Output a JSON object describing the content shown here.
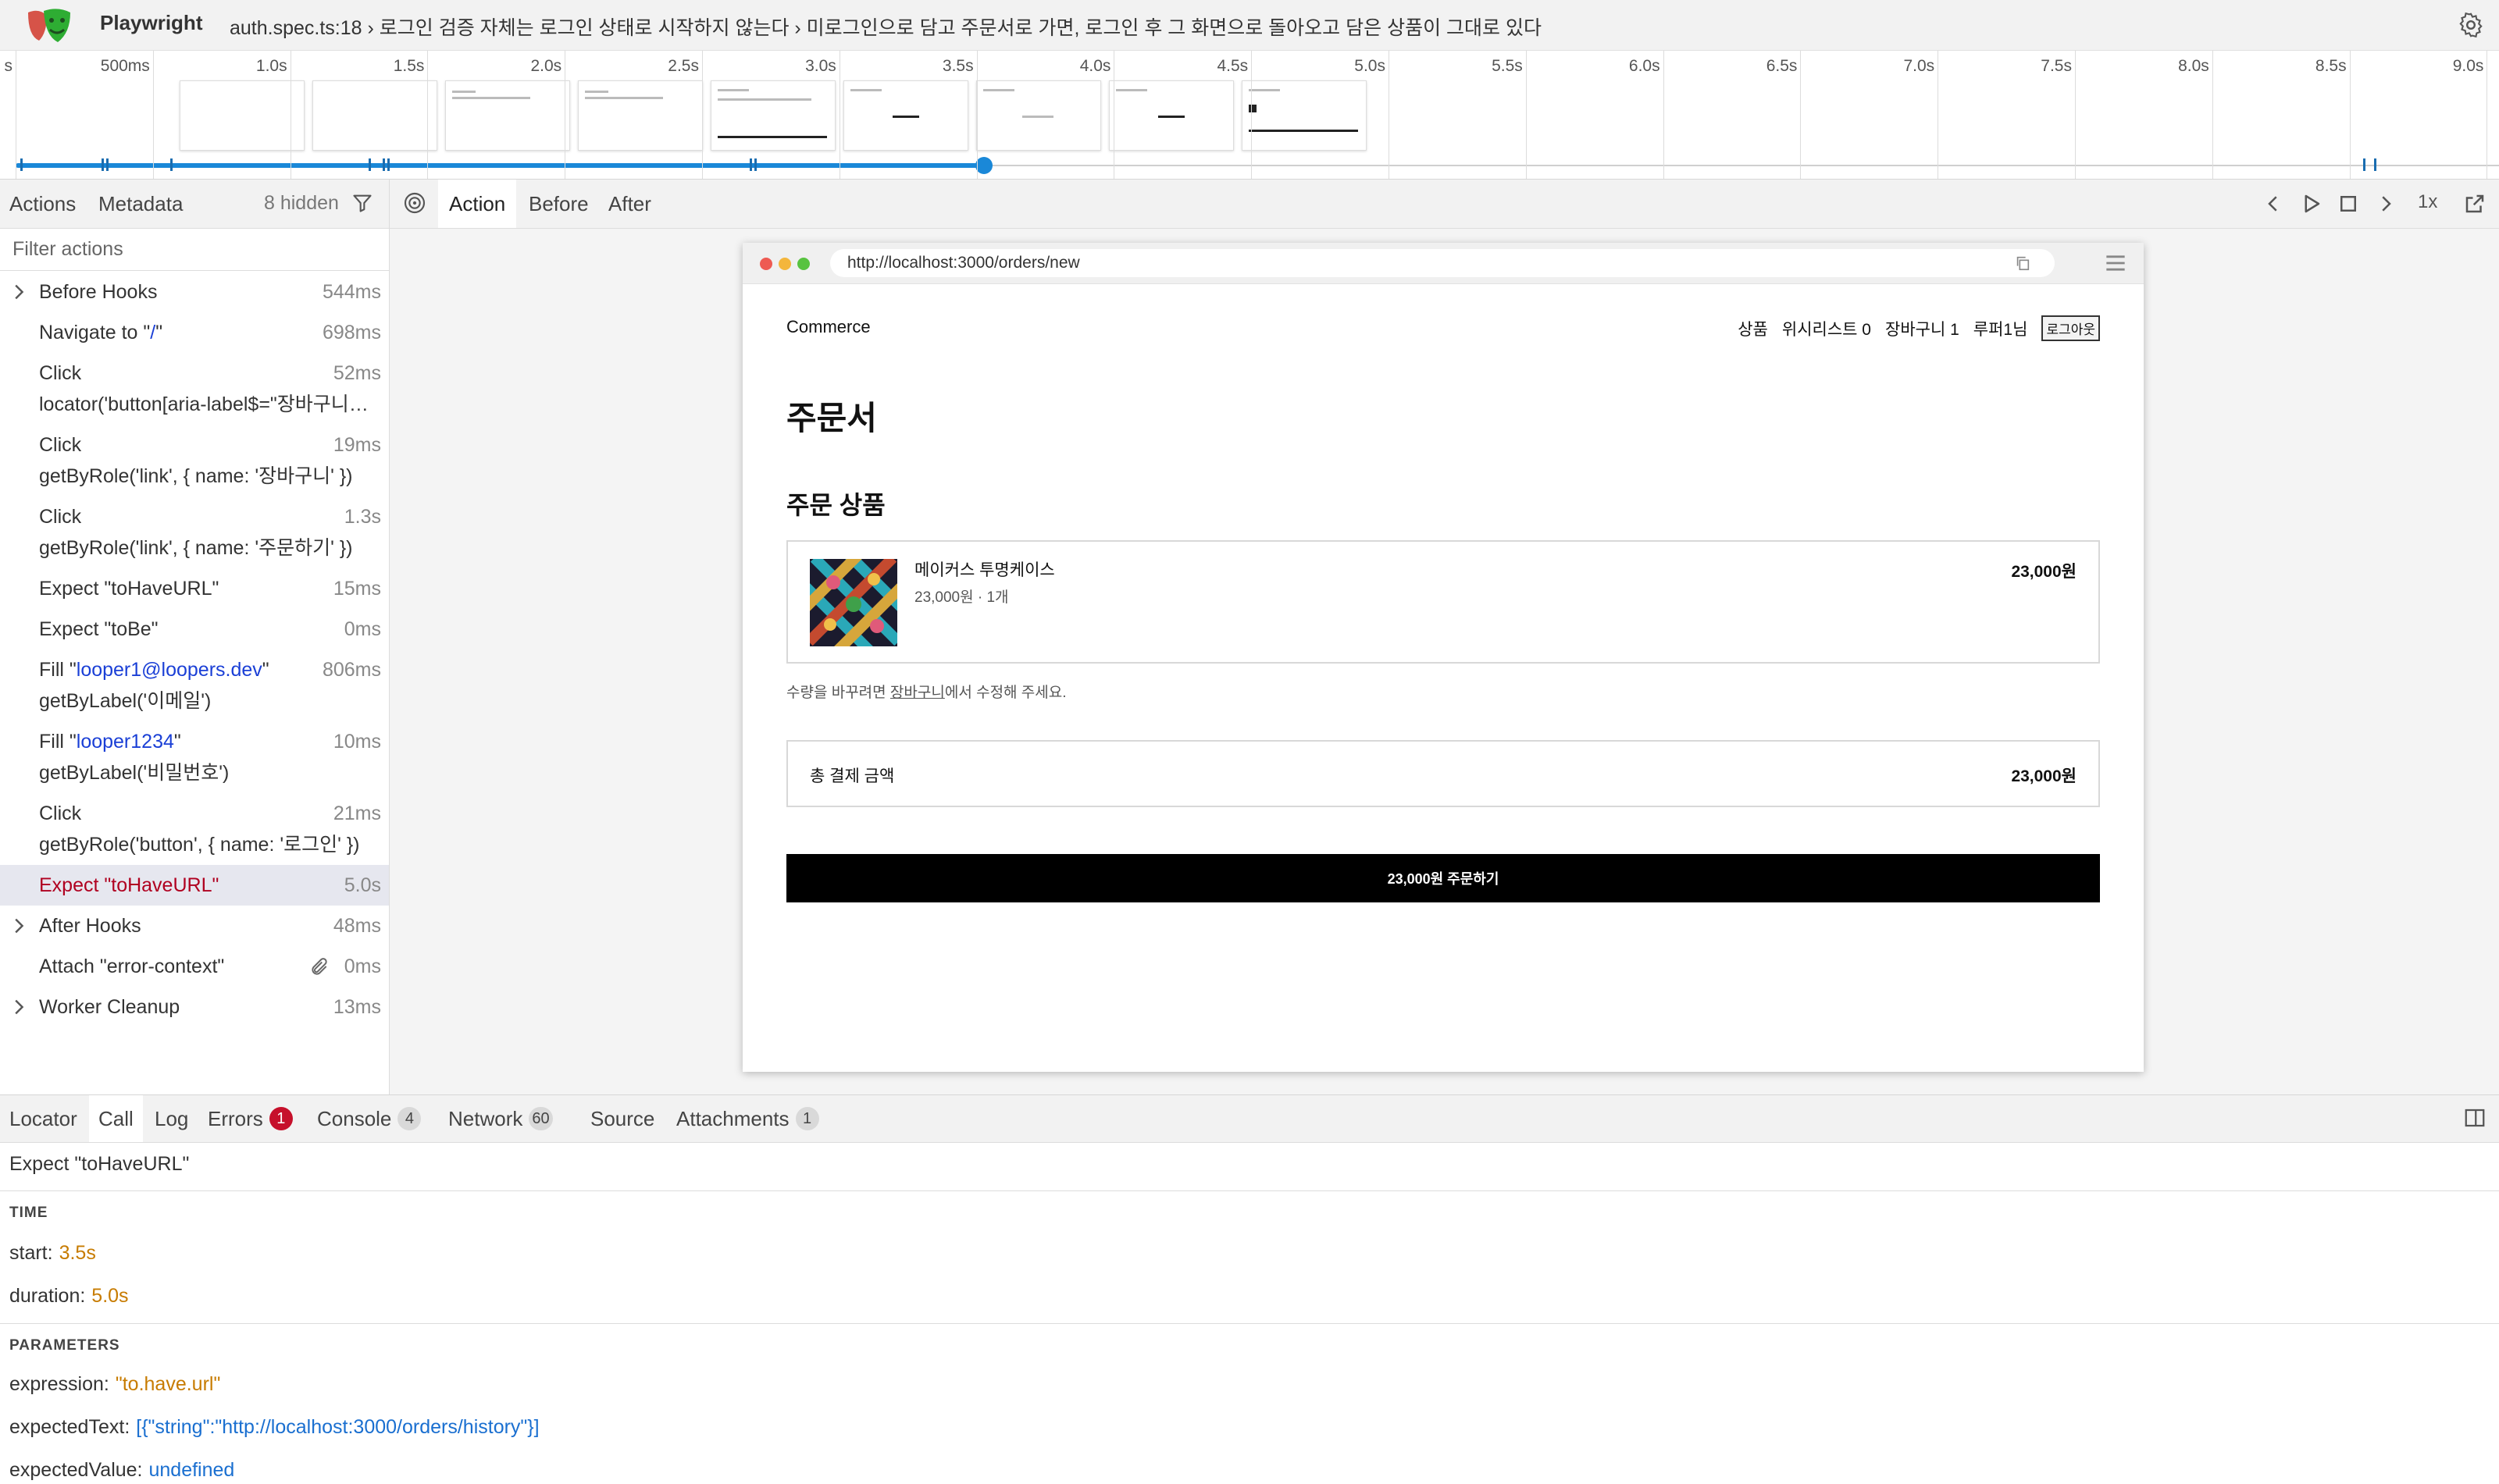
{
  "header": {
    "app_name": "Playwright",
    "title": "auth.spec.ts:18 › 로그인 검증 자체는 로그인 상태로 시작하지 않는다 › 미로그인으로 담고 주문서로 가면, 로그인 후 그 화면으로 돌아오고 담은 상품이 그대로 있다"
  },
  "timeline": {
    "ticks": [
      "s",
      "500ms",
      "1.0s",
      "1.5s",
      "2.0s",
      "2.5s",
      "3.0s",
      "3.5s",
      "4.0s",
      "4.5s",
      "5.0s",
      "5.5s",
      "6.0s",
      "6.5s",
      "7.0s",
      "7.5s",
      "8.0s",
      "8.5s",
      "9.0s"
    ],
    "progress_fraction": 0.39
  },
  "left_panel": {
    "tab_actions": "Actions",
    "tab_metadata": "Metadata",
    "hidden_count": "8 hidden",
    "filter_placeholder": "Filter actions",
    "actions": [
      {
        "line1": "Before Hooks",
        "duration": "544ms",
        "expandable": true
      },
      {
        "line1_prefix": "Navigate to \"",
        "line1_value": "/",
        "line1_suffix": "\"",
        "duration": "698ms"
      },
      {
        "line1": "Click",
        "line2": "locator('button[aria-label$=\"장바구니에 담기\"]').first()",
        "duration": "52ms"
      },
      {
        "line1": "Click",
        "line2": "getByRole('link', { name: '장바구니' })",
        "duration": "19ms"
      },
      {
        "line1": "Click",
        "line2": "getByRole('link', { name: '주문하기' })",
        "duration": "1.3s"
      },
      {
        "line1": "Expect \"toHaveURL\"",
        "duration": "15ms"
      },
      {
        "line1": "Expect \"toBe\"",
        "duration": "0ms"
      },
      {
        "line1_prefix": "Fill \"",
        "line1_value": "looper1@loopers.dev",
        "line1_suffix": "\"",
        "line2": "getByLabel('이메일')",
        "duration": "806ms"
      },
      {
        "line1_prefix": "Fill \"",
        "line1_value": "looper1234",
        "line1_suffix": "\"",
        "line2": "getByLabel('비밀번호')",
        "duration": "10ms"
      },
      {
        "line1": "Click",
        "line2": "getByRole('button', { name: '로그인' })",
        "duration": "21ms"
      },
      {
        "line1": "Expect \"toHaveURL\"",
        "duration": "5.0s",
        "selected": true
      },
      {
        "line1": "After Hooks",
        "duration": "48ms",
        "expandable": true
      },
      {
        "line1": "Attach \"error-context\"",
        "duration": "0ms",
        "attachment": true
      },
      {
        "line1": "Worker Cleanup",
        "duration": "13ms",
        "expandable": true
      }
    ]
  },
  "main_toolbar": {
    "tab_action": "Action",
    "tab_before": "Before",
    "tab_after": "After",
    "speed": "1x"
  },
  "snapshot": {
    "url": "http://localhost:3000/orders/new",
    "brand": "Commerce",
    "nav": {
      "products": "상품",
      "wishlist": "위시리스트 0",
      "cart": "장바구니 1",
      "user": "루퍼1님",
      "logout": "로그아웃"
    },
    "page_title": "주문서",
    "section_title": "주문 상품",
    "item": {
      "name": "메이커스 투명케이스",
      "meta": "23,000원 · 1개",
      "price": "23,000원"
    },
    "note_prefix": "수량을 바꾸려면 ",
    "note_link": "장바구니",
    "note_suffix": "에서 수정해 주세요.",
    "total_label": "총 결제 금액",
    "total_value": "23,000원",
    "order_button": "23,000원 주문하기"
  },
  "bottom_panel": {
    "tabs": {
      "locator": "Locator",
      "call": "Call",
      "log": "Log",
      "errors": "Errors",
      "errors_count": "1",
      "console": "Console",
      "console_count": "4",
      "network": "Network",
      "network_count": "60",
      "source": "Source",
      "attachments": "Attachments",
      "attachments_count": "1"
    },
    "call_title": "Expect \"toHaveURL\"",
    "time_header": "TIME",
    "start_label": "start:",
    "start_value": "3.5s",
    "duration_label": "duration:",
    "duration_value": "5.0s",
    "params_header": "PARAMETERS",
    "expression_label": "expression:",
    "expression_value": "\"to.have.url\"",
    "expected_text_label": "expectedText:",
    "expected_text_value": "[{\"string\":\"http://localhost:3000/orders/history\"}]",
    "expected_value_label": "expectedValue:",
    "expected_value_value": "undefined"
  },
  "colors": {
    "accent": "#1a88d8",
    "error": "#c6102b",
    "selected_row": "#e6e7ef",
    "value_orange": "#c77b00",
    "value_blue": "#1a6fd0"
  }
}
